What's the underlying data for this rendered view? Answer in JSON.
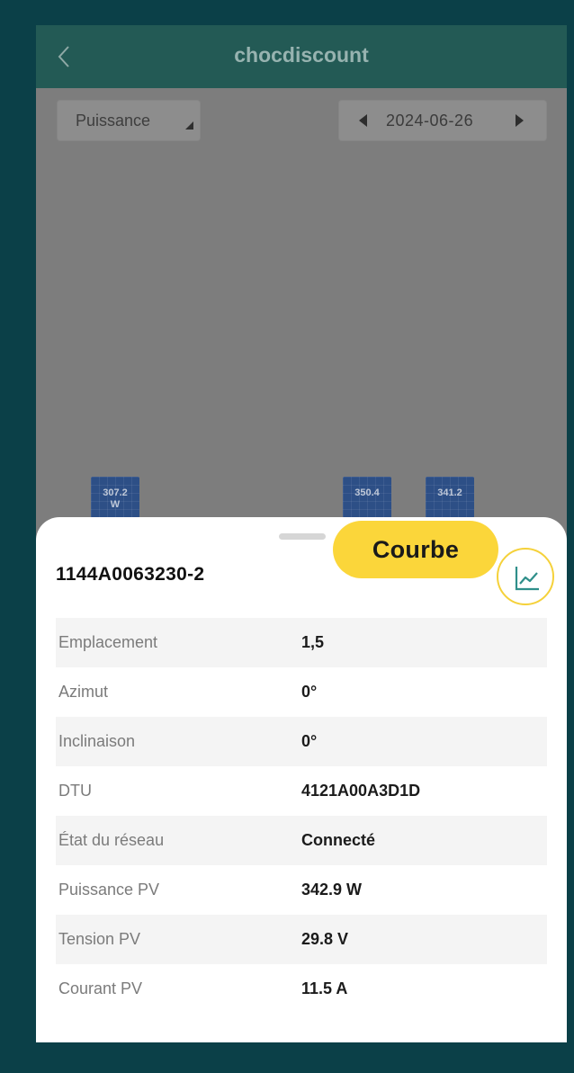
{
  "header": {
    "title": "chocdiscount",
    "back_icon": "chevron-left-icon"
  },
  "toolbar": {
    "metric": "Puissance",
    "date": "2024-06-26"
  },
  "panels": [
    {
      "value": "307.2",
      "unit": "W"
    },
    {
      "value": "350.4",
      "unit": ""
    },
    {
      "value": "341.2",
      "unit": ""
    }
  ],
  "sheet": {
    "callout": "Courbe",
    "device_id": "1144A0063230-2",
    "curve_icon": "line-chart-icon",
    "rows": [
      {
        "label": "Emplacement",
        "value": "1,5"
      },
      {
        "label": "Azimut",
        "value": "0°"
      },
      {
        "label": "Inclinaison",
        "value": "0°"
      },
      {
        "label": "DTU",
        "value": "4121A00A3D1D"
      },
      {
        "label": "État du réseau",
        "value": "Connecté"
      },
      {
        "label": "Puissance PV",
        "value": "342.9 W"
      },
      {
        "label": "Tension PV",
        "value": "29.8 V"
      },
      {
        "label": "Courant PV",
        "value": "11.5 A"
      }
    ]
  },
  "colors": {
    "outer_frame": "#0b4048",
    "header": "#235a55",
    "overlay_background": "#7d7d7d",
    "callout": "#fbd63a",
    "panel": "#2d4f86"
  }
}
